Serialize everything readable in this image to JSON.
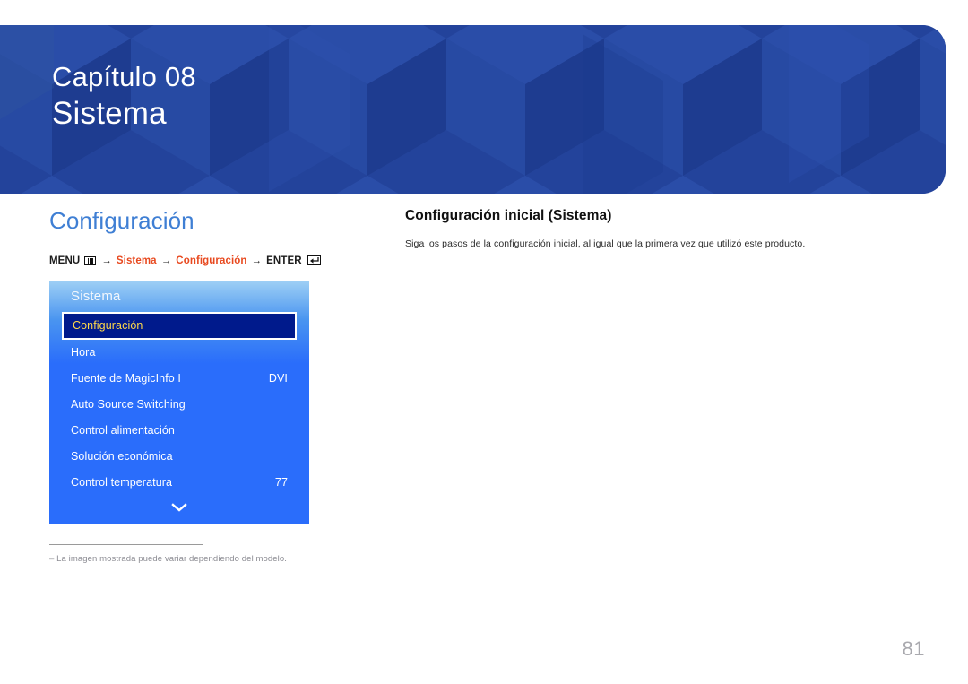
{
  "header": {
    "chapter_label": "Capítulo 08",
    "chapter_title": "Sistema",
    "bg_color": "#23439b"
  },
  "left_column": {
    "section_heading": "Configuración",
    "section_heading_color": "#3f7fd4",
    "breadcrumb": {
      "menu_label": "MENU",
      "menu_icon": "menu-grid-icon",
      "arrow1": "→",
      "item1": "Sistema",
      "arrow2": "→",
      "item2": "Configuración",
      "arrow3": "→",
      "enter_label": "ENTER",
      "enter_icon": "enter-key-icon",
      "highlight_color": "#e8491f"
    },
    "osd": {
      "title": "Sistema",
      "rows": [
        {
          "label": "Configuración",
          "value": "",
          "selected": true
        },
        {
          "label": "Hora",
          "value": "",
          "selected": false
        },
        {
          "label": "Fuente de MagicInfo I",
          "value": "DVI",
          "selected": false
        },
        {
          "label": "Auto Source Switching",
          "value": "",
          "selected": false
        },
        {
          "label": "Control alimentación",
          "value": "",
          "selected": false
        },
        {
          "label": "Solución económica",
          "value": "",
          "selected": false
        },
        {
          "label": "Control temperatura",
          "value": "77",
          "selected": false
        }
      ],
      "scroll_icon": "chevron-down-icon",
      "selected_text_color": "#ffd94a",
      "selected_bg_color": "#001a8c"
    },
    "footnote": "‒ La imagen mostrada puede variar dependiendo del modelo."
  },
  "right_column": {
    "topic_title": "Configuración inicial (Sistema)",
    "topic_body": "Siga los pasos de la configuración inicial, al igual que la primera vez que utilizó este producto."
  },
  "page_number": "81"
}
